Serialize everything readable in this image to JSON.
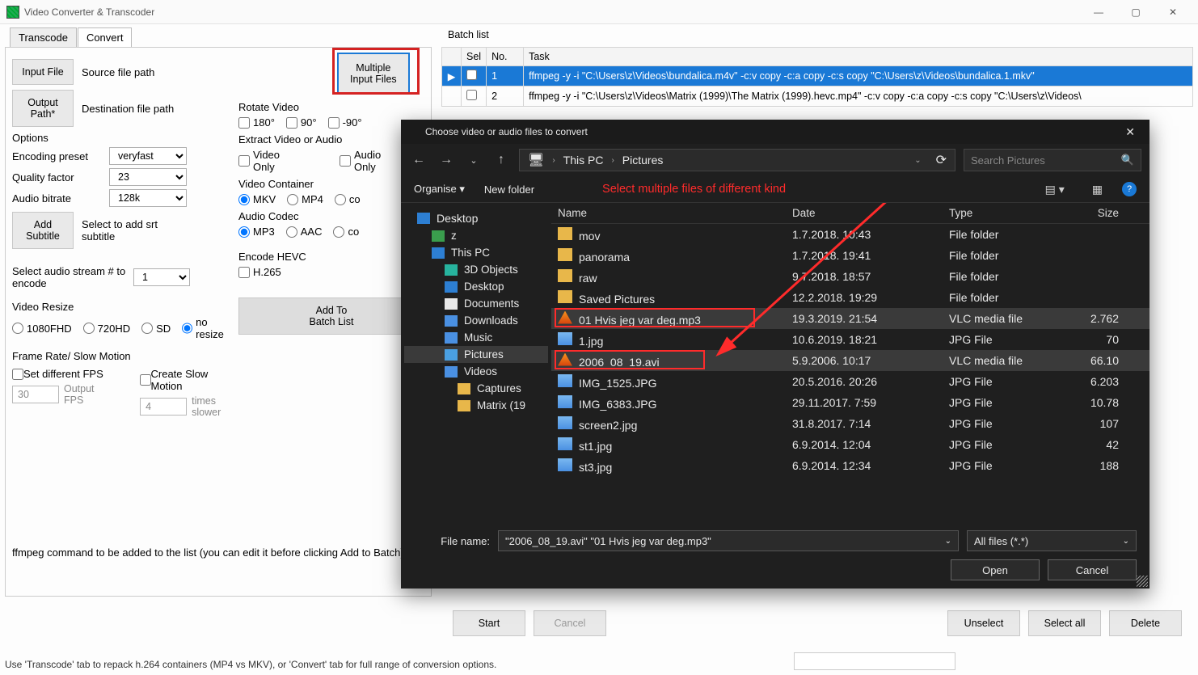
{
  "app": {
    "title": "Video Converter & Transcoder"
  },
  "tabs": {
    "transcode": "Transcode",
    "convert": "Convert"
  },
  "left": {
    "input_file": "Input File",
    "source_path": "Source file path",
    "output_path_btn": "Output\nPath*",
    "dest_path": "Destination file path",
    "multiple_input": "Multiple\nInput Files",
    "options": "Options",
    "encoding_preset": "Encoding preset",
    "preset_val": "veryfast",
    "quality": "Quality factor",
    "quality_val": "23",
    "audio_bitrate": "Audio bitrate",
    "bitrate_val": "128k",
    "add_subtitle": "Add\nSubtitle",
    "add_subtitle_note": "Select to add srt subtitle",
    "sel_audio": "Select audio stream # to encode",
    "sel_audio_val": "1",
    "resize": "Video Resize",
    "r1080": "1080FHD",
    "r720": "720HD",
    "rsd": "SD",
    "rno": "no resize",
    "fps_box": "Frame Rate/ Slow Motion",
    "fps_chk": "Set different FPS",
    "fps_in": "30",
    "fps_note": "Output FPS",
    "slow_chk": "Create Slow Motion",
    "slow_in": "4",
    "slow_note": "times slower",
    "rotate": "Rotate Video",
    "rot180": "180°",
    "rot90": "90°",
    "rotm90": "-90°",
    "extract": "Extract Video or Audio",
    "vonly": "Video\nOnly",
    "aonly": "Audio\nOnly",
    "vcontainer": "Video Container",
    "mkv": "MKV",
    "mp4": "MP4",
    "copy": "copy",
    "acodec": "Audio Codec",
    "mp3": "MP3",
    "aac": "AAC",
    "hevc": "Encode HEVC",
    "h265": "H.265",
    "add_batch": "Add To\nBatch List",
    "ffmpeg_note": "ffmpeg command to be added to the list (you can edit it before clicking Add to Batch)"
  },
  "batch": {
    "title": "Batch list",
    "cols": {
      "sel": "Sel",
      "no": "No.",
      "task": "Task"
    },
    "rows": [
      {
        "no": "1",
        "task": "ffmpeg -y -i \"C:\\Users\\z\\Videos\\bundalica.m4v\" -c:v copy -c:a copy -c:s copy \"C:\\Users\\z\\Videos\\bundalica.1.mkv\""
      },
      {
        "no": "2",
        "task": "ffmpeg -y -i \"C:\\Users\\z\\Videos\\Matrix (1999)\\The Matrix (1999).hevc.mp4\" -c:v copy -c:a copy -c:s copy \"C:\\Users\\z\\Videos\\"
      }
    ],
    "start": "Start",
    "cancel": "Cancel",
    "unselect": "Unselect",
    "selectall": "Select all",
    "delete": "Delete"
  },
  "dialog": {
    "title": "Choose video or audio files to convert",
    "path": {
      "thispc": "This PC",
      "pictures": "Pictures"
    },
    "search_ph": "Search Pictures",
    "organise": "Organise",
    "newfolder": "New folder",
    "annot": "Select multiple files of different kind",
    "tree": [
      "Desktop",
      "z",
      "This PC",
      "3D Objects",
      "Desktop",
      "Documents",
      "Downloads",
      "Music",
      "Pictures",
      "Videos",
      "Captures",
      "Matrix (19"
    ],
    "cols": {
      "name": "Name",
      "date": "Date",
      "type": "Type",
      "size": "Size"
    },
    "files": [
      {
        "n": "mov",
        "d": "1.7.2018. 10:43",
        "t": "File folder",
        "s": "",
        "k": "folder"
      },
      {
        "n": "panorama",
        "d": "1.7.2018. 19:41",
        "t": "File folder",
        "s": "",
        "k": "folder"
      },
      {
        "n": "raw",
        "d": "9.7.2018. 18:57",
        "t": "File folder",
        "s": "",
        "k": "folder"
      },
      {
        "n": "Saved Pictures",
        "d": "12.2.2018. 19:29",
        "t": "File folder",
        "s": "",
        "k": "folder"
      },
      {
        "n": "01 Hvis jeg var deg.mp3",
        "d": "19.3.2019. 21:54",
        "t": "VLC media file",
        "s": "2.762",
        "k": "vlc",
        "sel": true
      },
      {
        "n": "1.jpg",
        "d": "10.6.2019. 18:21",
        "t": "JPG File",
        "s": "70",
        "k": "img"
      },
      {
        "n": "2006_08_19.avi",
        "d": "5.9.2006. 10:17",
        "t": "VLC media file",
        "s": "66.10",
        "k": "vlc",
        "sel": true
      },
      {
        "n": "IMG_1525.JPG",
        "d": "20.5.2016. 20:26",
        "t": "JPG File",
        "s": "6.203",
        "k": "img"
      },
      {
        "n": "IMG_6383.JPG",
        "d": "29.11.2017. 7:59",
        "t": "JPG File",
        "s": "10.78",
        "k": "img"
      },
      {
        "n": "screen2.jpg",
        "d": "31.8.2017. 7:14",
        "t": "JPG File",
        "s": "107",
        "k": "img"
      },
      {
        "n": "st1.jpg",
        "d": "6.9.2014. 12:04",
        "t": "JPG File",
        "s": "42",
        "k": "img"
      },
      {
        "n": "st3.jpg",
        "d": "6.9.2014. 12:34",
        "t": "JPG File",
        "s": "188",
        "k": "img"
      }
    ],
    "filename_lbl": "File name:",
    "filename_val": "\"2006_08_19.avi\" \"01 Hvis jeg var deg.mp3\"",
    "filter": "All files (*.*)",
    "open": "Open",
    "cancel": "Cancel"
  },
  "status": "Use 'Transcode' tab to repack h.264 containers (MP4 vs MKV), or 'Convert' tab for full range of conversion options."
}
